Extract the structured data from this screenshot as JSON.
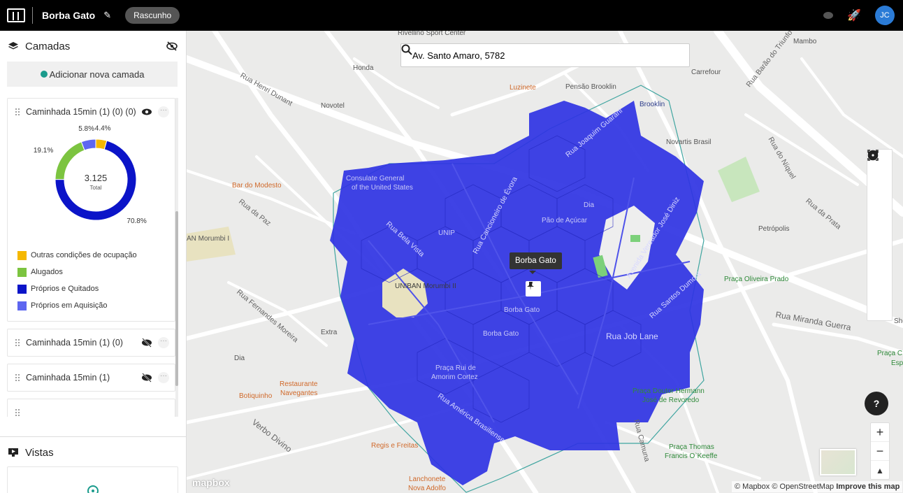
{
  "topbar": {
    "title": "Borba Gato",
    "status": "Rascunho",
    "avatar_initials": "JC"
  },
  "sidebar": {
    "layers_title": "Camadas",
    "add_layer_label": "Adicionar nova camada",
    "layers": [
      {
        "name": "Caminhada 15min (1) (0) (0)",
        "visible": true
      },
      {
        "name": "Caminhada 15min (1) (0)",
        "visible": false
      },
      {
        "name": "Caminhada 15min (1)",
        "visible": false
      }
    ],
    "views_title": "Vistas"
  },
  "chart_data": {
    "type": "pie",
    "total_value": "3.125",
    "total_label": "Total",
    "categories": [
      "Outras condições de ocupação",
      "Alugados",
      "Próprios e Quitados",
      "Próprios em Aquisição"
    ],
    "values": [
      4.4,
      19.1,
      70.8,
      5.8
    ],
    "labels": [
      "4.4%",
      "19.1%",
      "70.8%",
      "5.8%"
    ],
    "colors": [
      "#f5b800",
      "#7cc440",
      "#0b14c8",
      "#5d66f0"
    ]
  },
  "map": {
    "search_value": "Av. Santo Amaro, 5782",
    "tooltip": "Borba Gato",
    "help_label": "?",
    "zoom_in": "+",
    "zoom_out": "−",
    "attribution_mapbox": "© Mapbox",
    "attribution_osm": "© OpenStreetMap",
    "attribution_improve": "Improve this map",
    "logo_text": "mapbox",
    "labels": {
      "rivellino": "Rivellino Sport Center",
      "honda": "Honda",
      "luzinete": "Luzinete",
      "pensao": "Pensão Brooklin",
      "carrefour": "Carrefour",
      "mambo": "Mambo",
      "brooklin": "Brooklin",
      "novotel": "Novotel",
      "novartis": "Novartis Brasil",
      "bar_modesto": "Bar do Modesto",
      "consulado": "Consulate General",
      "consulado2": "of the United States",
      "dia1": "Dia",
      "pao_acucar": "Pão de Açúcar",
      "unip": "UNIP",
      "morumbi": "AN Morumbi I",
      "petropolis": "Petrópolis",
      "praca_oliveira": "Praça Oliveira Prado",
      "uniban": "UNIBAN Morumbi II",
      "borba_station": "Borba Gato",
      "borba_station2": "Borba Gato",
      "extra": "Extra",
      "dia2": "Dia",
      "praca_rui": "Praça Rui de",
      "praca_rui2": "Amorim Cortez",
      "restaurante": "Restaurante",
      "restaurante2": "Navegantes",
      "botiquinho": "Botiquinho",
      "praca_doutor": "Praça Doutor Hermann",
      "praca_doutor2": "José de Revoredo",
      "regis": "Regis e Freitas",
      "lanchonete": "Lanchonete",
      "lanchonete2": "Nova Adolfo",
      "praca_thomas": "Praça Thomas",
      "praca_thomas2": "Francis O`Keeffe",
      "praca_c": "Praça C",
      "esp": "Esp",
      "shop": "Sho",
      "job_lane": "Rua Job Lane",
      "miranda": "Rua Miranda Guerra",
      "verbo": "Verbo Divino",
      "henri": "Rua Henri Dunant",
      "joaquim": "Rua Joaquim Guarani",
      "america": "Rua América Brasiliense",
      "bela_vista": "Rua Bela Vista",
      "cancioneiro": "Rua Cancioneiro de Évora",
      "vereador": "Avenida Vereador José Diniz",
      "santos": "Rua Santos Dumont",
      "da_paz": "Rua da Paz",
      "prata": "Rua da Prata",
      "niquel": "Rua do Níquel",
      "camuna": "Rua Camuna",
      "barao": "Rua Barão do Triunfo",
      "fernandes": "Rua Fernandes Moreira"
    }
  }
}
